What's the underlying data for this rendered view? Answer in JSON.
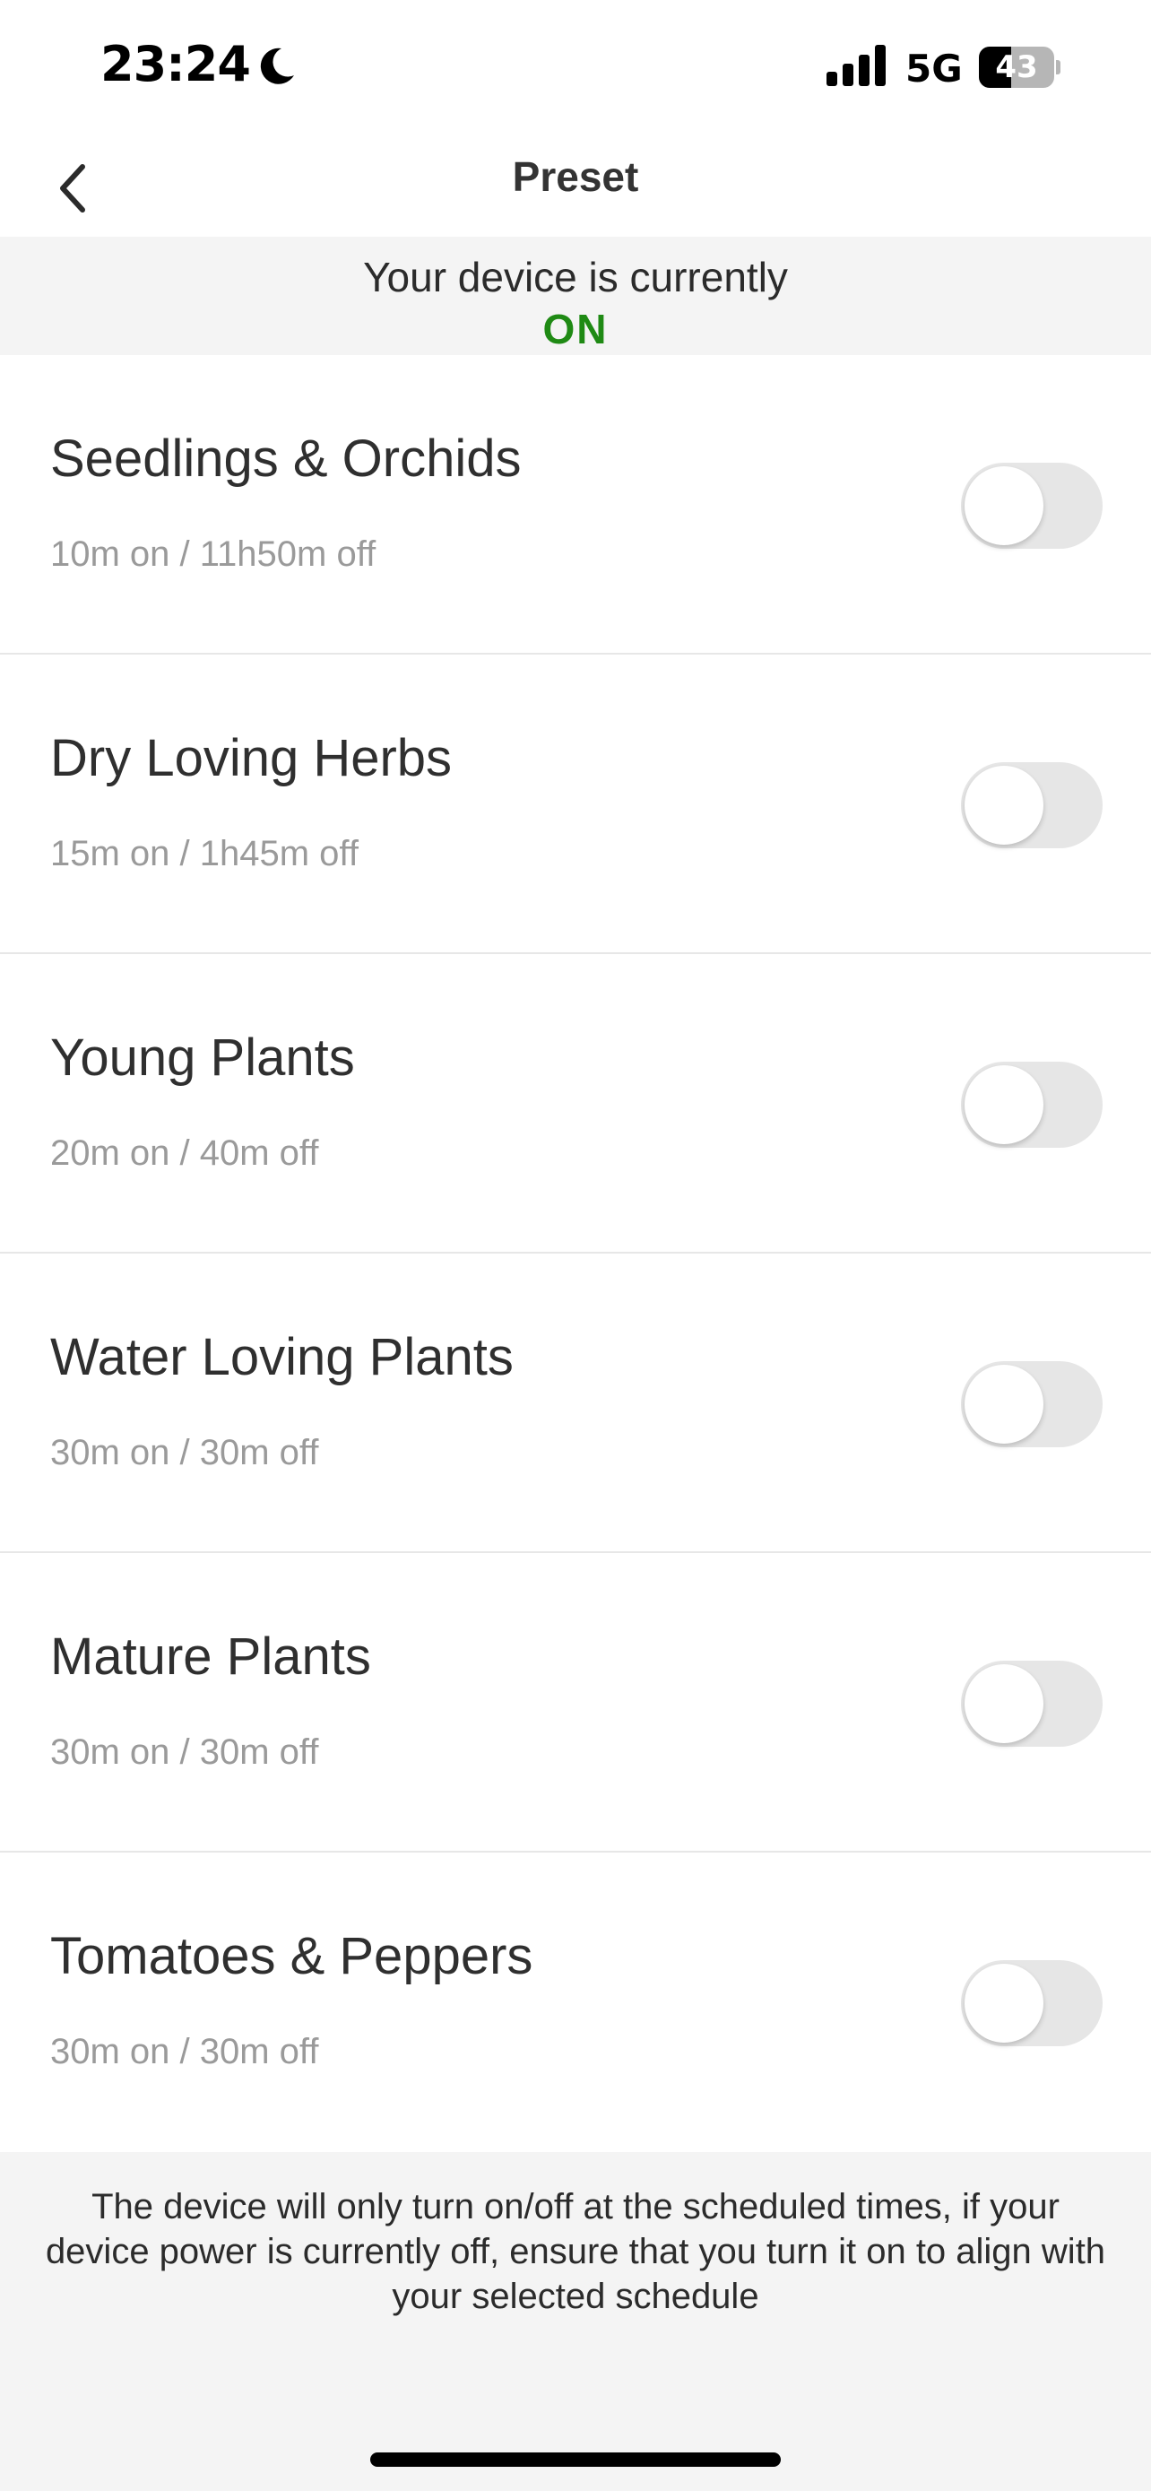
{
  "status_bar": {
    "time": "23:24",
    "network": "5G",
    "battery_level": "43",
    "battery_fraction": 0.43,
    "icons": [
      "moon-icon",
      "signal-icon",
      "battery-icon"
    ]
  },
  "header": {
    "title": "Preset",
    "back_icon": "chevron-left-icon"
  },
  "device_status": {
    "text": "Your device is currently",
    "state": "ON",
    "state_color": "#1f8a14"
  },
  "presets": [
    {
      "name": "Seedlings & Orchids",
      "schedule": "10m on / 11h50m off",
      "enabled": false
    },
    {
      "name": "Dry Loving Herbs",
      "schedule": "15m on / 1h45m off",
      "enabled": false
    },
    {
      "name": "Young Plants",
      "schedule": "20m on / 40m off",
      "enabled": false
    },
    {
      "name": "Water Loving Plants",
      "schedule": "30m on / 30m off",
      "enabled": false
    },
    {
      "name": "Mature Plants",
      "schedule": "30m on / 30m off",
      "enabled": false
    },
    {
      "name": "Tomatoes & Peppers",
      "schedule": "30m on / 30m off",
      "enabled": false
    }
  ],
  "footer": {
    "note": "The device will only turn on/off at the scheduled times, if your device power is currently off, ensure that you turn it on to align with your selected schedule"
  },
  "colors": {
    "background": "#f4f4f4",
    "toggle_off": "#e6e6e6",
    "text_primary": "#2f2f2f",
    "text_secondary": "#9a9a9a"
  }
}
